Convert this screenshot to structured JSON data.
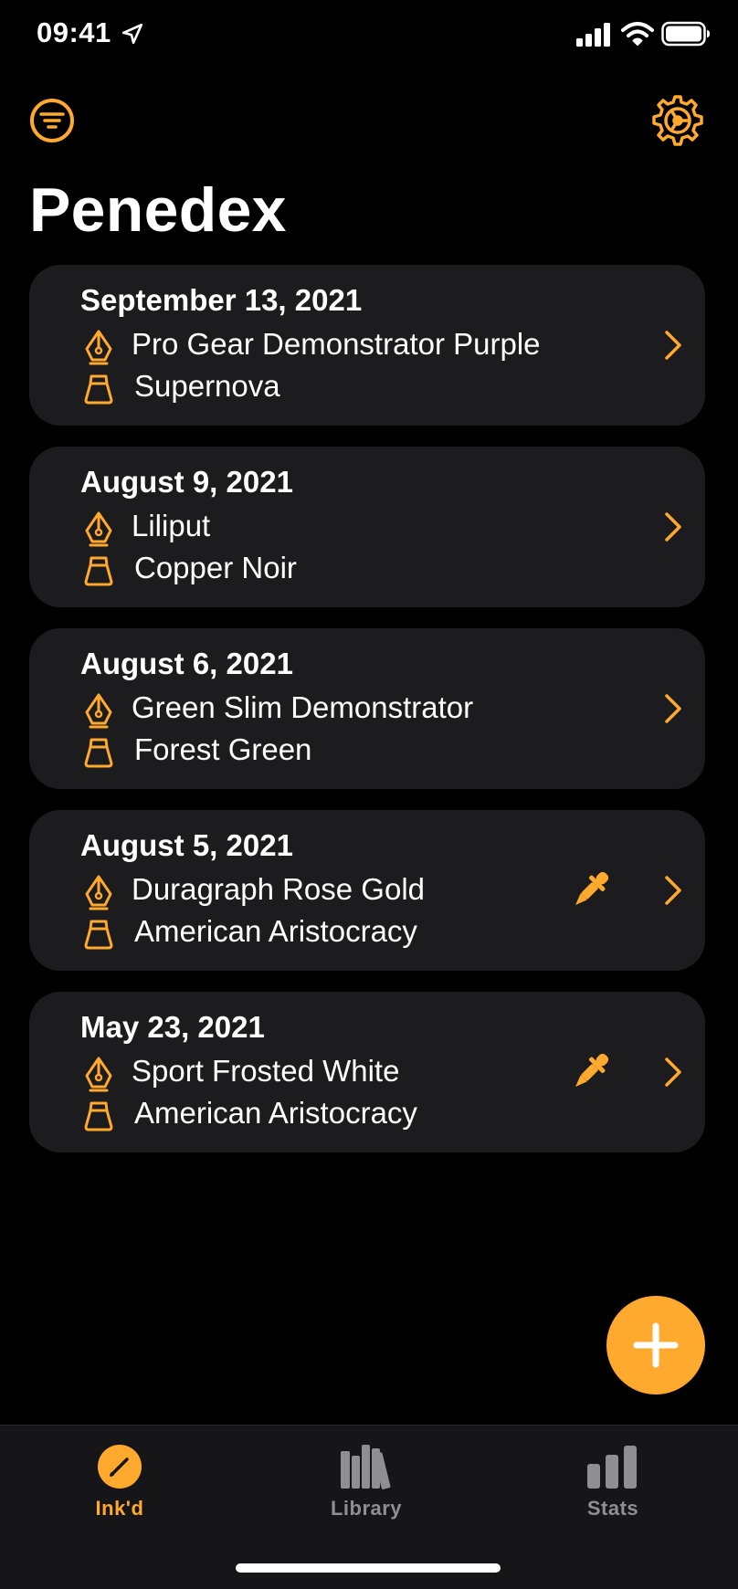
{
  "status_bar": {
    "time": "09:41",
    "location_icon": "location-arrow-icon",
    "signal_icon": "cellular-signal-icon",
    "wifi_icon": "wifi-icon",
    "battery_icon": "battery-icon"
  },
  "nav": {
    "filter_icon": "filter-icon",
    "settings_icon": "gear-icon"
  },
  "page_title": "Penedex",
  "entries": [
    {
      "date": "September 13, 2021",
      "pen": "Pro Gear Demonstrator Purple",
      "ink": "Supernova",
      "has_dropper": false
    },
    {
      "date": "August 9, 2021",
      "pen": "Liliput",
      "ink": "Copper Noir",
      "has_dropper": false
    },
    {
      "date": "August 6, 2021",
      "pen": "Green Slim Demonstrator",
      "ink": "Forest Green",
      "has_dropper": false
    },
    {
      "date": "August 5, 2021",
      "pen": "Duragraph Rose Gold",
      "ink": "American Aristocracy",
      "has_dropper": true
    },
    {
      "date": "May 23, 2021",
      "pen": "Sport Frosted White",
      "ink": "American Aristocracy",
      "has_dropper": true
    }
  ],
  "fab": {
    "icon": "plus-icon"
  },
  "tabs": [
    {
      "label": "Ink'd",
      "icon": "pen-circle-icon",
      "active": true
    },
    {
      "label": "Library",
      "icon": "books-icon",
      "active": false
    },
    {
      "label": "Stats",
      "icon": "bar-chart-icon",
      "active": false
    }
  ],
  "colors": {
    "accent": "#ffa92e",
    "background": "#000000",
    "card": "#1c1c1e",
    "tab_bar": "#161618",
    "inactive": "#8e8e93"
  }
}
